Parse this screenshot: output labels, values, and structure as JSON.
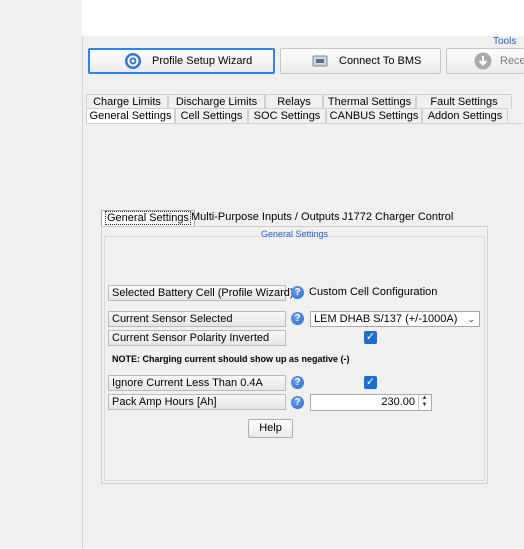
{
  "toolbar": {
    "tools_label": "Tools",
    "profile_wizard": "Profile Setup Wizard",
    "connect_bms": "Connect To BMS",
    "receive": "Rece"
  },
  "tabs_row1": [
    "Charge Limits",
    "Discharge Limits",
    "Relays",
    "Thermal Settings",
    "Fault Settings"
  ],
  "tabs_row2": [
    "General Settings",
    "Cell Settings",
    "SOC Settings",
    "CANBUS Settings",
    "Addon Settings"
  ],
  "active_tab": "General Settings",
  "subtabs": [
    "General Settings",
    "Multi-Purpose Inputs / Outputs",
    "J1772 Charger Control"
  ],
  "group": {
    "title": "General Settings",
    "selected_cell_label": "Selected Battery Cell (Profile Wizard)",
    "selected_cell_value": "Custom Cell Configuration",
    "current_sensor_label": "Current Sensor Selected",
    "current_sensor_value": "LEM DHAB S/137 (+/-1000A)",
    "polarity_label": "Current Sensor Polarity Inverted",
    "polarity_checked": true,
    "note": "NOTE: Charging current should show up as negative (-)",
    "ignore_current_label": "Ignore Current Less Than 0.4A",
    "ignore_current_checked": true,
    "pack_ah_label": "Pack Amp Hours [Ah]",
    "pack_ah_value": "230.00",
    "help_button": "Help"
  },
  "colors": {
    "accent": "#1c6fd1",
    "group_title": "#2a5ebd",
    "background": "#f0f0f0"
  }
}
